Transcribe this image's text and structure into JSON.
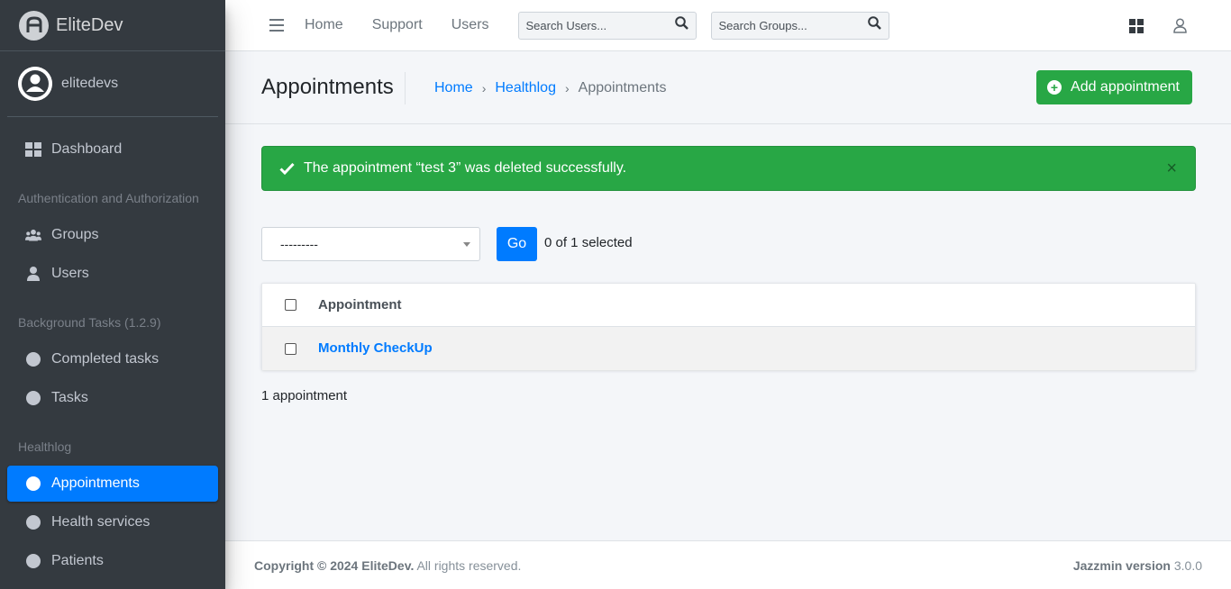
{
  "brand": {
    "name": "EliteDev"
  },
  "user": {
    "name": "elitedevs"
  },
  "sidebar": {
    "dashboard": "Dashboard",
    "sections": [
      {
        "header": "Authentication and Authorization",
        "items": [
          "Groups",
          "Users"
        ]
      },
      {
        "header": "Background Tasks (1.2.9)",
        "items": [
          "Completed tasks",
          "Tasks"
        ]
      },
      {
        "header": "Healthlog",
        "items": [
          "Appointments",
          "Health services",
          "Patients"
        ]
      }
    ],
    "active_item": "Appointments"
  },
  "topbar": {
    "links": [
      "Home",
      "Support",
      "Users"
    ],
    "search_users_placeholder": "Search Users...",
    "search_groups_placeholder": "Search Groups..."
  },
  "header": {
    "title": "Appointments",
    "breadcrumb": [
      "Home",
      "Healthlog",
      "Appointments"
    ],
    "add_button": "Add appointment"
  },
  "alert": {
    "message": "The appointment “test 3” was deleted successfully.",
    "close": "×"
  },
  "actions": {
    "select_value": "---------",
    "go_label": "Go",
    "selected_count": "0 of 1 selected"
  },
  "table": {
    "column": "Appointment",
    "rows": [
      "Monthly CheckUp"
    ],
    "count_text": "1 appointment"
  },
  "footer": {
    "copyright_bold": "Copyright © 2024 EliteDev.",
    "copyright_rest": " All rights reserved.",
    "version_label": "Jazzmin version",
    "version": " 3.0.0"
  },
  "colors": {
    "primary": "#007bff",
    "success": "#28a745",
    "sidebar": "#343a40"
  }
}
